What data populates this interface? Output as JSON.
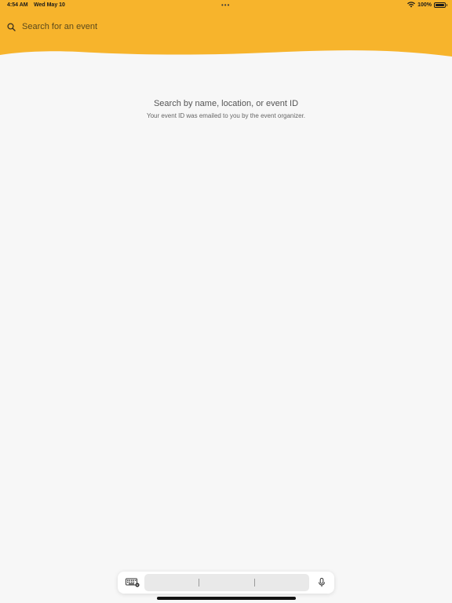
{
  "status_bar": {
    "time": "4:54 AM",
    "date": "Wed May 10",
    "multitask_dots": "•••",
    "battery_text": "100%",
    "battery_level": 1.0
  },
  "colors": {
    "header_background": "#f7b42c",
    "page_background": "#f7f7f7"
  },
  "search": {
    "icon": "search-icon",
    "placeholder": "Search for an event"
  },
  "empty_state": {
    "title": "Search by name, location, or event ID",
    "subtitle": "Your event ID was emailed to you by the event organizer."
  },
  "keyboard_bar": {
    "keyboard_icon": "keyboard-icon",
    "mic_icon": "microphone-icon",
    "suggestions": [
      "",
      "",
      ""
    ]
  }
}
